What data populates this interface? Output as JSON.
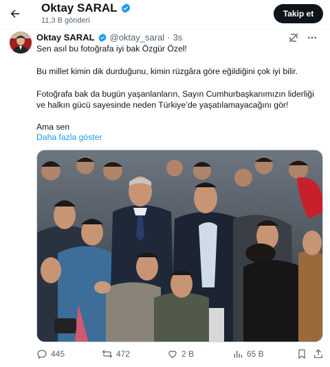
{
  "header": {
    "back_icon": "arrow-left-icon",
    "name": "Oktay SARAL",
    "post_count": "11,3 B gönderi",
    "follow_label": "Takip et"
  },
  "tweet": {
    "author_name": "Oktay SARAL",
    "handle": "@oktay_saral",
    "separator": "·",
    "time": "3s",
    "verified_color": "#1d9bf0",
    "lines": [
      "Sen asıl bu fotoğrafa iyi bak Özgür Özel!",
      "Bu millet kimin dik durduğunu, kimin rüzgâra göre eğildiğini çok iyi bilir.",
      "Fotoğrafa bak da bugün yaşanlanların, Sayın Cumhurbaşkanımızın liderliği",
      "ve halkın gücü sayesinde neden Türkiye’de yaşatılamayacağını gör!",
      "Ama sen"
    ],
    "show_more": "Daha fazla göster",
    "actions": {
      "replies": "445",
      "reposts": "472",
      "likes": "2 B",
      "views": "65 B"
    }
  },
  "colors": {
    "text": "#0f1419",
    "muted": "#536471",
    "accent": "#1d9bf0"
  }
}
